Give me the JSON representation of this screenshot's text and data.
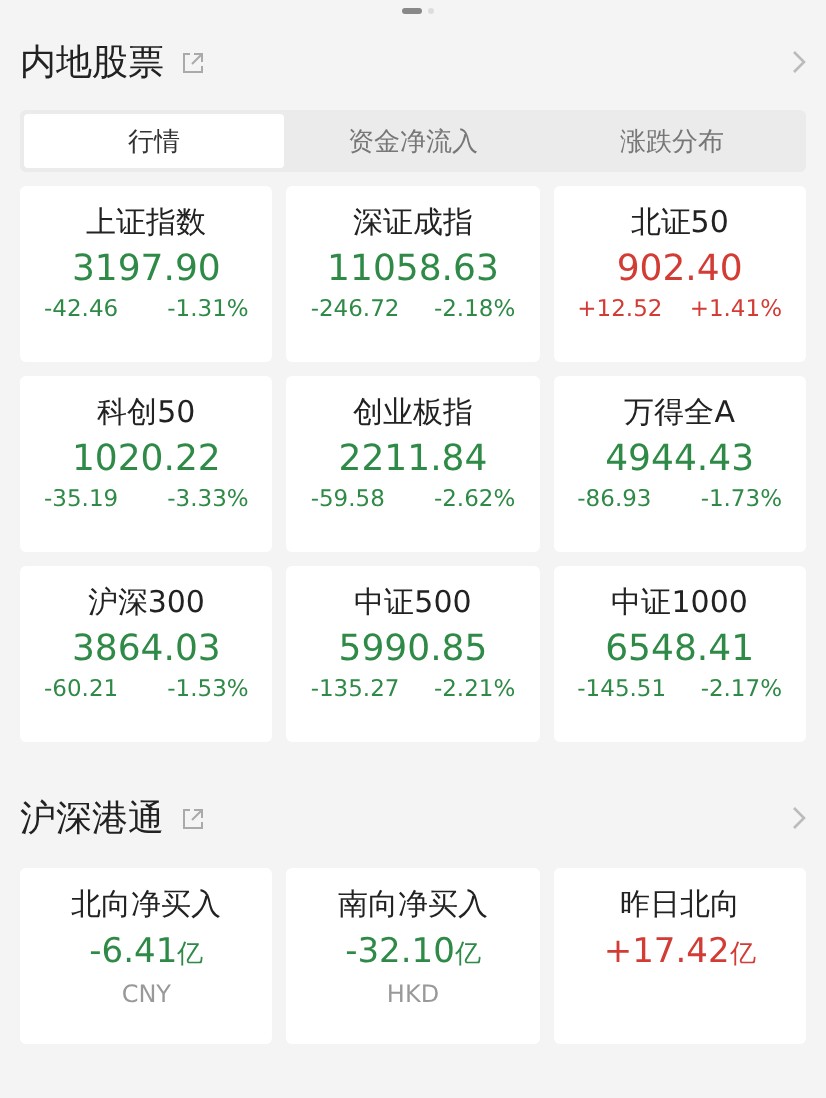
{
  "pager": [
    {
      "selected": true
    },
    {
      "selected": false
    }
  ],
  "mainland": {
    "title": "内地股票",
    "tabs": [
      {
        "label": "行情",
        "selected": true
      },
      {
        "label": "资金净流入",
        "selected": false
      },
      {
        "label": "涨跌分布",
        "selected": false
      }
    ],
    "indices": [
      {
        "name": "上证指数",
        "value": "3197.90",
        "change": "-42.46",
        "percent": "-1.31%",
        "color": "#2f8a47"
      },
      {
        "name": "深证成指",
        "value": "11058.63",
        "change": "-246.72",
        "percent": "-2.18%",
        "color": "#2f8a47"
      },
      {
        "name": "北证50",
        "value": "902.40",
        "change": "+12.52",
        "percent": "+1.41%",
        "color": "#d23c35"
      },
      {
        "name": "科创50",
        "value": "1020.22",
        "change": "-35.19",
        "percent": "-3.33%",
        "color": "#2f8a47"
      },
      {
        "name": "创业板指",
        "value": "2211.84",
        "change": "-59.58",
        "percent": "-2.62%",
        "color": "#2f8a47"
      },
      {
        "name": "万得全A",
        "value": "4944.43",
        "change": "-86.93",
        "percent": "-1.73%",
        "color": "#2f8a47"
      },
      {
        "name": "沪深300",
        "value": "3864.03",
        "change": "-60.21",
        "percent": "-1.53%",
        "color": "#2f8a47"
      },
      {
        "name": "中证500",
        "value": "5990.85",
        "change": "-135.27",
        "percent": "-2.21%",
        "color": "#2f8a47"
      },
      {
        "name": "中证1000",
        "value": "6548.41",
        "change": "-145.51",
        "percent": "-2.17%",
        "color": "#2f8a47"
      }
    ]
  },
  "connect": {
    "title": "沪深港通",
    "flows": [
      {
        "name": "北向净买入",
        "amount": "-6.41",
        "unit": "亿",
        "currency": "CNY",
        "color": "#2f8a47"
      },
      {
        "name": "南向净买入",
        "amount": "-32.10",
        "unit": "亿",
        "currency": "HKD",
        "color": "#2f8a47"
      },
      {
        "name": "昨日北向",
        "amount": "+17.42",
        "unit": "亿",
        "color": "#d23c35"
      }
    ]
  }
}
